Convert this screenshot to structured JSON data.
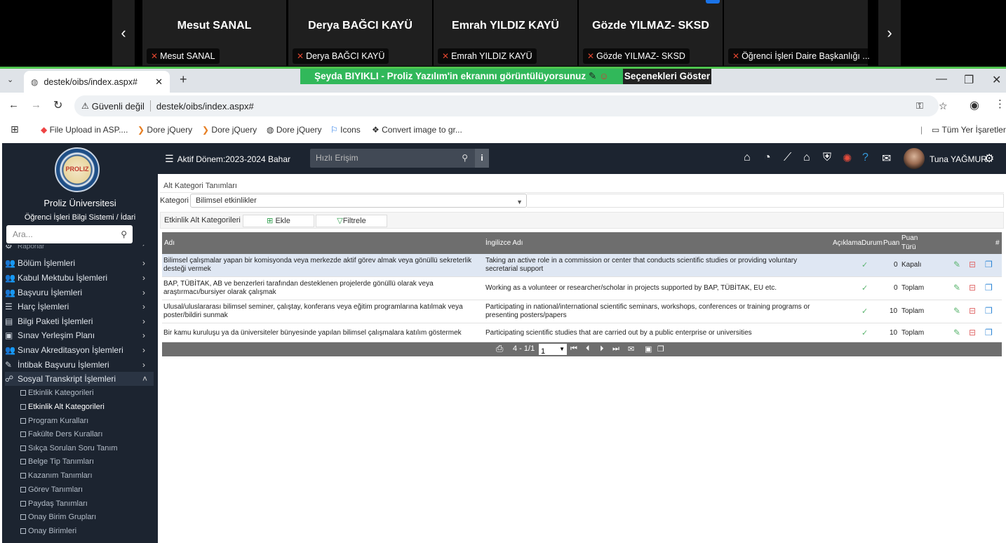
{
  "meeting": {
    "prev_arrow": "‹",
    "next_arrow": "›",
    "participants": [
      {
        "name": "Mesut SANAL",
        "tag": "Mesut SANAL"
      },
      {
        "name": "Derya BAĞCI KAYÜ",
        "tag": "Derya BAĞCI KAYÜ"
      },
      {
        "name": "Emrah YILDIZ KAYÜ",
        "tag": "Emrah YILDIZ KAYÜ"
      },
      {
        "name": "Gözde YILMAZ- SKSD",
        "tag": "Gözde YILMAZ- SKSD"
      },
      {
        "name": "",
        "tag": "Öğrenci İşleri Daire Başkanlığı ..."
      }
    ],
    "share_banner": "Şeyda BIYIKLI - Proliz Yazılım'in ekranını görüntülüyorsunuz",
    "share_options": "Seçenekleri Göster"
  },
  "browser": {
    "tab_title": "destek/oibs/index.aspx#",
    "security": "Güvenli değil",
    "url": "destek/oibs/index.aspx#",
    "bookmarks": [
      "File Upload in ASP....",
      "Dore jQuery",
      "Dore jQuery",
      "Dore jQuery",
      "Icons",
      "Convert image to gr..."
    ],
    "all_bookmarks": "Tüm Yer İşaretleri"
  },
  "sidebar": {
    "university": "Proliz Üniversitesi",
    "system": "Öğrenci İşleri Bilgi Sistemi / İdari",
    "search_placeholder": "Ara...",
    "partial_item": "Raporlar",
    "menu": [
      {
        "label": "Bölüm İşlemleri",
        "icon": "users-icon"
      },
      {
        "label": "Kabul Mektubu İşlemleri",
        "icon": "group-icon"
      },
      {
        "label": "Başvuru İşlemleri",
        "icon": "group-icon"
      },
      {
        "label": "Harç İşlemleri",
        "icon": "list-icon"
      },
      {
        "label": "Bilgi Paketi İşlemleri",
        "icon": "package-icon"
      },
      {
        "label": "Sınav Yerleşim Planı",
        "icon": "clipboard-icon"
      },
      {
        "label": "Sınav Akreditasyon İşlemleri",
        "icon": "group-icon"
      },
      {
        "label": "İntibak Başvuru İşlemleri",
        "icon": "paperclip-icon"
      },
      {
        "label": "Sosyal Transkript İşlemleri",
        "icon": "share-icon"
      }
    ],
    "submenu": [
      "Etkinlik Kategorileri",
      "Etkinlik Alt Kategorileri",
      "Program Kuralları",
      "Fakülte Ders Kuralları",
      "Sıkça Sorulan Soru Tanım",
      "Belge Tip Tanımları",
      "Kazanım Tanımları",
      "Görev Tanımları",
      "Paydaş Tanımları",
      "Onay Birim Grupları",
      "Onay Birimleri"
    ]
  },
  "topbar": {
    "term": "Aktif Dönem:2023-2024 Bahar",
    "quick_placeholder": "Hızlı Erişim",
    "user": "Tuna YAĞMUR"
  },
  "content": {
    "title": "Alt Kategori Tanımları",
    "category_label": "Kategori",
    "category_value": "Bilimsel etkinlikler",
    "section_label": "Etkinlik Alt Kategorileri",
    "add_label": "Ekle",
    "filter_label": "Filtrele",
    "columns": {
      "name": "Adı",
      "english": "İngilizce Adı",
      "desc": "Açıklama",
      "status": "Durum",
      "points": "Puan",
      "ptype1": "Puan",
      "ptype2": "Türü",
      "hash": "#"
    },
    "rows": [
      {
        "name": "Bilimsel çalışmalar yapan bir komisyonda veya merkezde aktif görev almak veya gönüllü sekreterlik desteği vermek",
        "english": "Taking an active role in a commission or center that conducts scientific studies or providing voluntary secretarial support",
        "status": "✓",
        "points": "0",
        "type": "Kapalı"
      },
      {
        "name": "BAP, TÜBİTAK, AB ve benzerleri tarafından desteklenen projelerde gönüllü olarak veya araştırmacı/bursiyer olarak çalışmak",
        "english": "Working as a volunteer or researcher/scholar in projects supported by BAP, TÜBİTAK, EU etc.",
        "status": "✓",
        "points": "0",
        "type": "Toplam"
      },
      {
        "name": "Ulusal/uluslararası bilimsel seminer, çalıştay, konferans veya eğitim programlarına katılmak veya poster/bildiri sunmak",
        "english": "Participating in national/international scientific seminars, workshops, conferences or training programs or presenting posters/papers",
        "status": "✓",
        "points": "10",
        "type": "Toplam"
      },
      {
        "name": "Bir kamu kuruluşu ya da üniversiteler bünyesinde yapılan bilimsel çalışmalara katılım göstermek",
        "english": "Participating scientific studies that are carried out by a public enterprise or universities",
        "status": "✓",
        "points": "10",
        "type": "Toplam"
      }
    ],
    "pager": {
      "range": "4 - 1/1",
      "page": "1"
    }
  }
}
